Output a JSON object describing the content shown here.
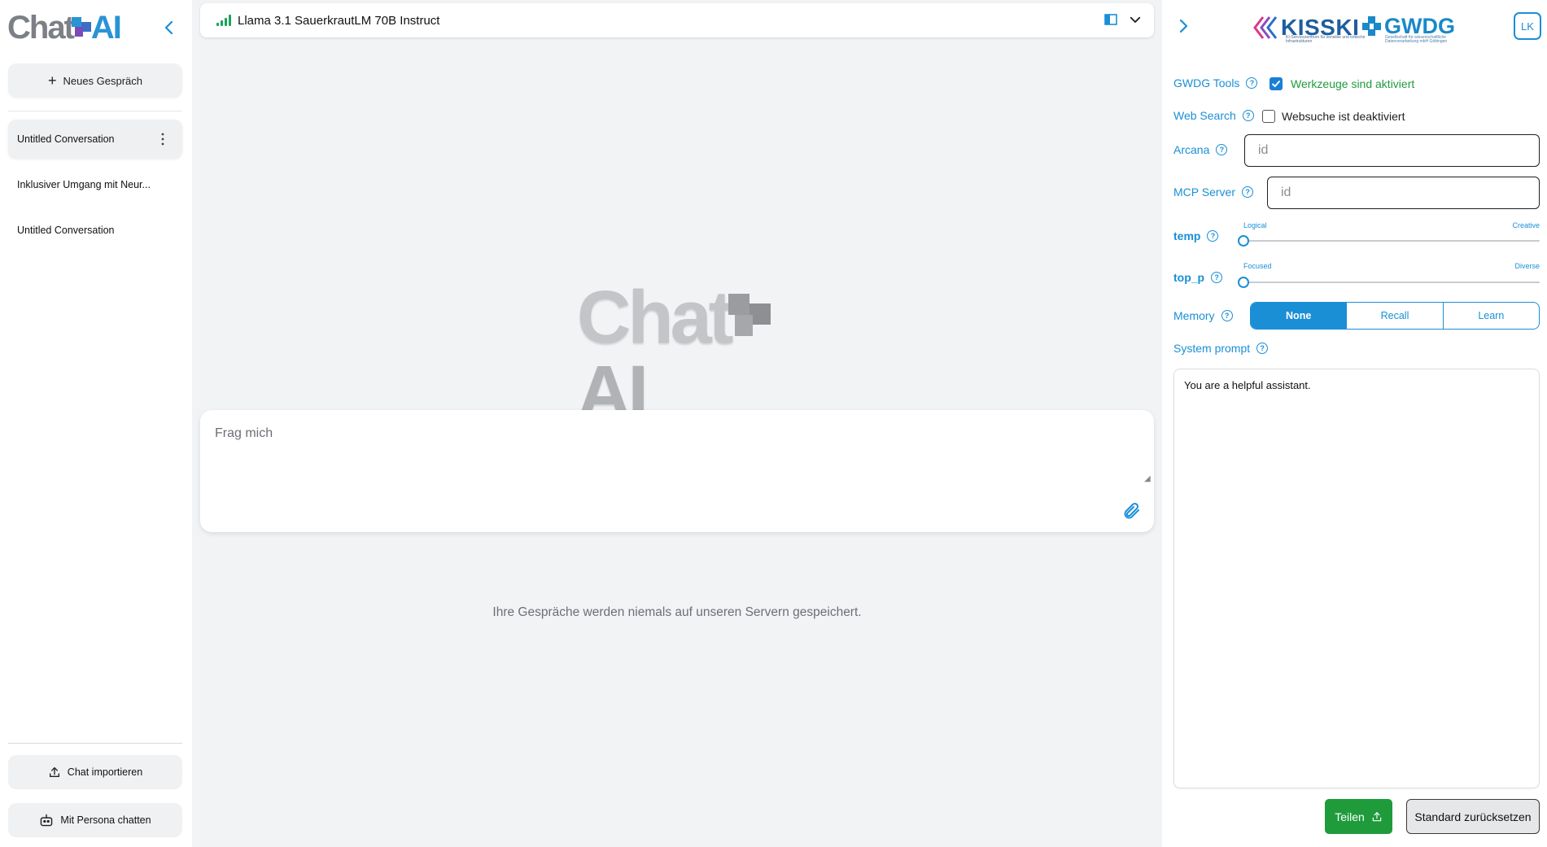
{
  "app": {
    "logo_text_chat": "Chat",
    "logo_text_ai": "AI"
  },
  "sidebar": {
    "new_chat_label": "Neues Gespräch",
    "conversations": [
      {
        "label": "Untitled Conversation",
        "active": true
      },
      {
        "label": "Inklusiver Umgang mit Neur...",
        "active": false
      },
      {
        "label": "Untitled Conversation",
        "active": false
      }
    ],
    "import_label": "Chat importieren",
    "persona_label": "Mit Persona chatten"
  },
  "topbar": {
    "model_name": "Llama 3.1 SauerkrautLM 70B Instruct",
    "status_color": "#19a558"
  },
  "main": {
    "watermark_chat": "Chat",
    "watermark_ai": "AI",
    "prompt_placeholder": "Frag mich",
    "privacy_note": "Ihre Gespräche werden niemals auf unseren Servern gespeichert."
  },
  "rpanel": {
    "kisski_text": "KISSKI",
    "kisski_sub": "KI-Servicezentrum für sensible und kritische Infrastrukturen",
    "gwdg_text": "GWDG",
    "gwdg_sub": "Gesellschaft für wissenschaftliche Datenverarbeitung mbH Göttingen",
    "avatar_initials": "LK",
    "gwdg_tools": {
      "label": "GWDG Tools",
      "checkbox_label": "Werkzeuge sind aktiviert",
      "checked": true
    },
    "web_search": {
      "label": "Web Search",
      "checkbox_label": "Websuche ist deaktiviert",
      "checked": false
    },
    "arcana": {
      "label": "Arcana",
      "placeholder": "id",
      "value": ""
    },
    "mcp": {
      "label": "MCP Server",
      "placeholder": "id",
      "value": ""
    },
    "temp": {
      "label": "temp",
      "left_label": "Logical",
      "right_label": "Creative",
      "value": 0
    },
    "top_p": {
      "label": "top_p",
      "left_label": "Focused",
      "right_label": "Diverse",
      "value": 0
    },
    "memory": {
      "label": "Memory",
      "options": [
        "None",
        "Recall",
        "Learn"
      ],
      "selected": "None"
    },
    "system_prompt": {
      "label": "System prompt",
      "value": "You are a helpful assistant."
    },
    "share_label": "Teilen",
    "reset_label": "Standard zurücksetzen"
  },
  "colors": {
    "accent": "#1a8fd6",
    "share_green": "#1f9b3c",
    "checkbox_label_green": "#1f9b3c"
  }
}
